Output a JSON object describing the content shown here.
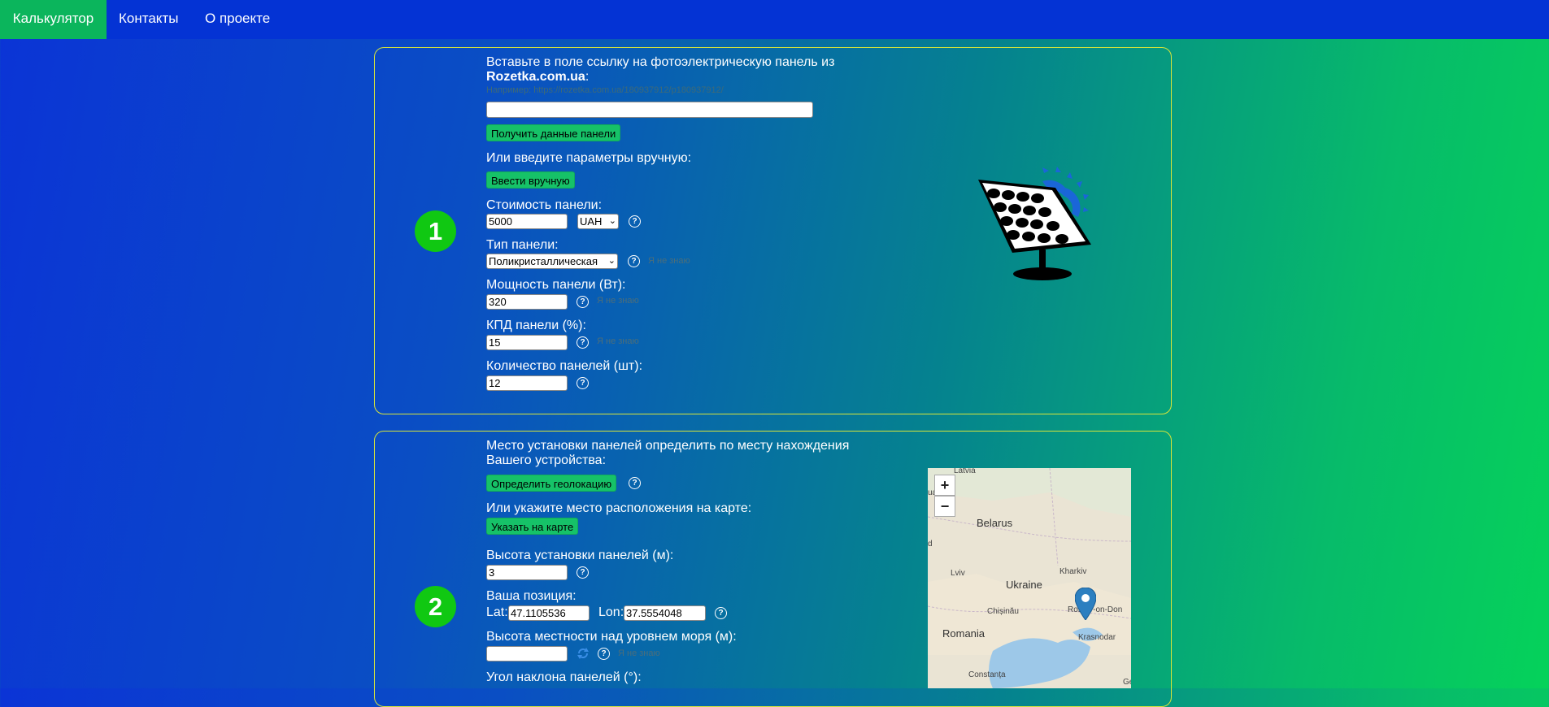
{
  "nav": {
    "items": [
      {
        "label": "Калькулятор",
        "active": true
      },
      {
        "label": "Контакты"
      },
      {
        "label": "О проекте"
      }
    ]
  },
  "step1": {
    "number": "1",
    "intro": "Вставьте в поле ссылку на фотоэлектрическую панель из",
    "site": "Rozetka.com.ua",
    "colon": ":",
    "example": "Например: https://rozetka.com.ua/180937912/p180937912/",
    "url_value": "",
    "get_data_button": "Получить данные панели",
    "manual_text": "Или введите параметры вручную:",
    "manual_button": "Ввести вручную",
    "cost_label": "Стоимость панели:",
    "cost_value": "5000",
    "currency": "UAH",
    "type_label": "Тип панели:",
    "type_value": "Поликристаллическая",
    "power_label": "Мощность панели (Вт):",
    "power_value": "320",
    "efficiency_label": "КПД панели (%):",
    "efficiency_value": "15",
    "count_label": "Количество панелей (шт):",
    "count_value": "12",
    "dont_know": "Я не знаю",
    "help": "?"
  },
  "step2": {
    "number": "2",
    "geo_text_1": "Место установки панелей определить по месту нахождения",
    "geo_text_2": "Вашего устройства:",
    "geo_button": "Определить геолокацию",
    "map_text": "Или укажите место расположения на карте:",
    "map_button": "Указать на карте",
    "height_label": "Высота установки панелей (м):",
    "height_value": "3",
    "position_label": "Ваша позиция:",
    "lat_label": "Lat:",
    "lat_value": "47.1105536",
    "lon_label": "Lon:",
    "lon_value": "37.5554048",
    "altitude_label": "Высота местности над уровнем моря (м):",
    "altitude_value": "",
    "tilt_label": "Угол наклона панелей (°):",
    "dont_know": "Я не знаю",
    "help": "?"
  },
  "map": {
    "zoom_in": "+",
    "zoom_out": "−",
    "countries": [
      "Latvia",
      "Belarus",
      "Ukraine",
      "Romania"
    ],
    "cities": [
      "Lviv",
      "Kharkiv",
      "Chișinău",
      "Rostov-on-Don",
      "Krasnodar",
      "Constanța",
      "uania",
      "d",
      "Ge"
    ],
    "marker_icon": "map-marker-icon",
    "marker_color": "#2c7fc0"
  },
  "colors": {
    "accent": "#16c268",
    "nav_bg": "#0433d4",
    "badge": "#10c812",
    "card_border": "#d8e53a"
  }
}
